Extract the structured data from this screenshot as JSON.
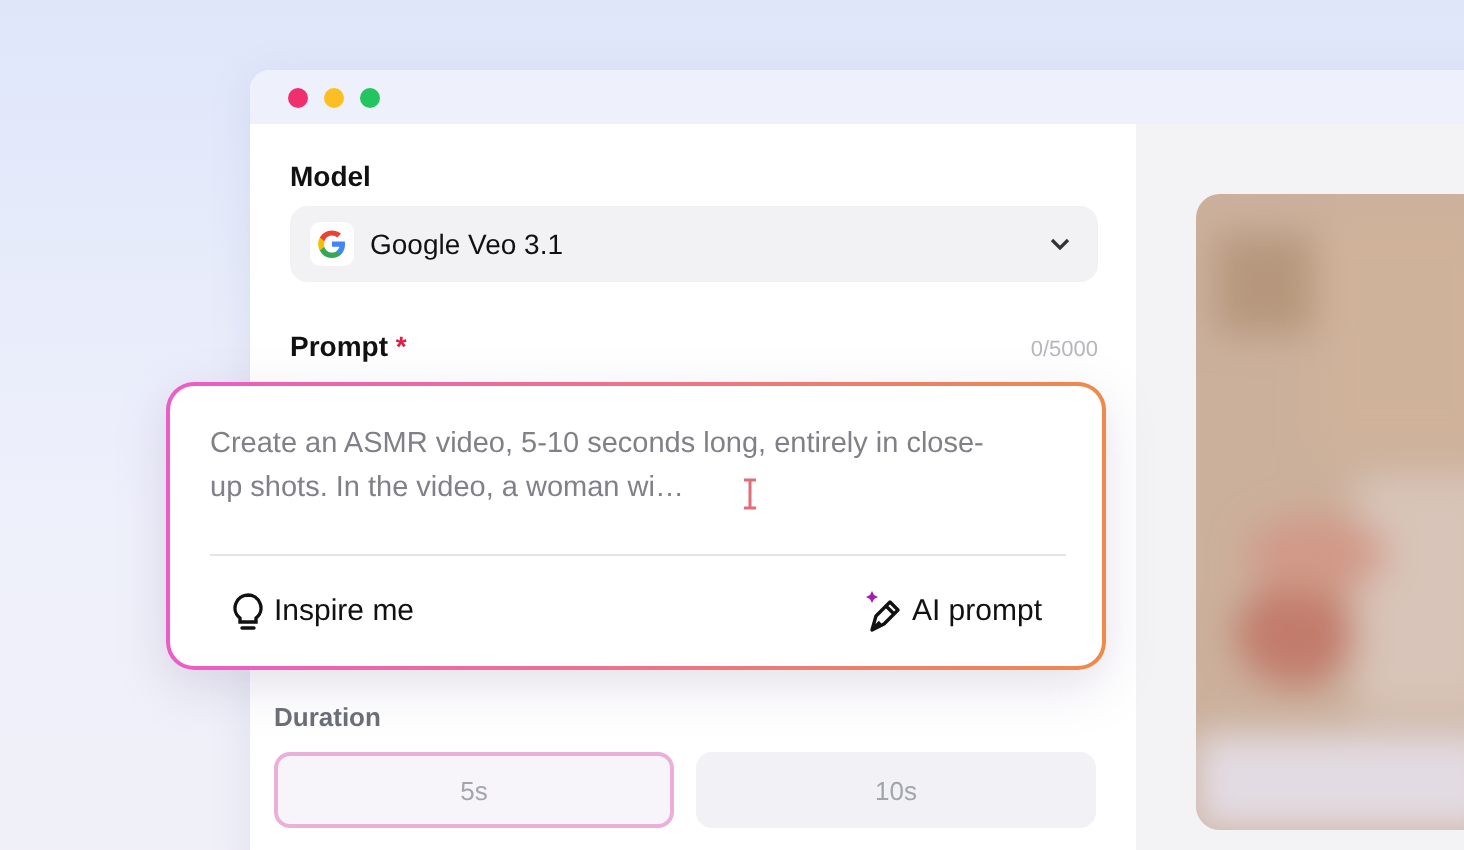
{
  "window": {
    "controls": [
      {
        "color": "#f0306e"
      },
      {
        "color": "#fbbf24"
      },
      {
        "color": "#22c55e"
      }
    ]
  },
  "model": {
    "label": "Model",
    "value": "Google Veo 3.1"
  },
  "prompt": {
    "label": "Prompt",
    "required_mark": "*",
    "counter": "0/5000",
    "placeholder": "Create an ASMR video, 5-10 seconds long, entirely in close-up shots. In the video, a woman wi…",
    "actions": [
      {
        "kind": "inspire",
        "label": "Inspire me"
      },
      {
        "kind": "ai",
        "label": "AI prompt"
      }
    ]
  },
  "duration": {
    "label": "Duration",
    "options": [
      {
        "label": "5s",
        "selected": true
      },
      {
        "label": "10s",
        "selected": false
      }
    ]
  }
}
